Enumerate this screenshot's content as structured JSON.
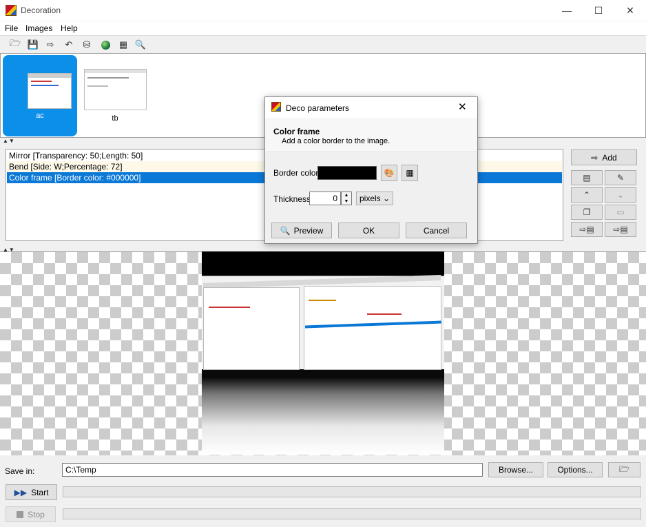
{
  "window": {
    "title": "Decoration"
  },
  "menu": [
    "File",
    "Images",
    "Help"
  ],
  "toolbar_icons": [
    "open-icon",
    "save-icon",
    "export-icon",
    "undo-icon",
    "database-icon",
    "globe-icon",
    "grid-icon",
    "zoom-icon"
  ],
  "thumbnails": [
    {
      "label": "ac",
      "selected": true
    },
    {
      "label": "tb",
      "selected": false
    }
  ],
  "filters": [
    "Mirror [Transparency: 50;Length: 50]",
    "Bend [Side: W;Percentage: 72]",
    "Color frame [Border color: #000000]"
  ],
  "side": {
    "add_label": "Add"
  },
  "bottom": {
    "save_in_label": "Save in:",
    "save_path": "C:\\Temp",
    "browse_label": "Browse...",
    "options_label": "Options...",
    "start_label": "Start",
    "stop_label": "Stop",
    "start_progress": 0,
    "stop_progress": 0
  },
  "dialog": {
    "title": "Deco parameters",
    "heading": "Color frame",
    "description": "Add a color border to the image.",
    "border_color_label": "Border color",
    "border_color": "#000000",
    "thickness_label": "Thickness",
    "thickness_value": "0",
    "unit": "pixels",
    "preview_label": "Preview",
    "ok_label": "OK",
    "cancel_label": "Cancel"
  },
  "colors": {
    "accent": "#0a78d7",
    "thumb_selected": "#0c8fe8"
  }
}
